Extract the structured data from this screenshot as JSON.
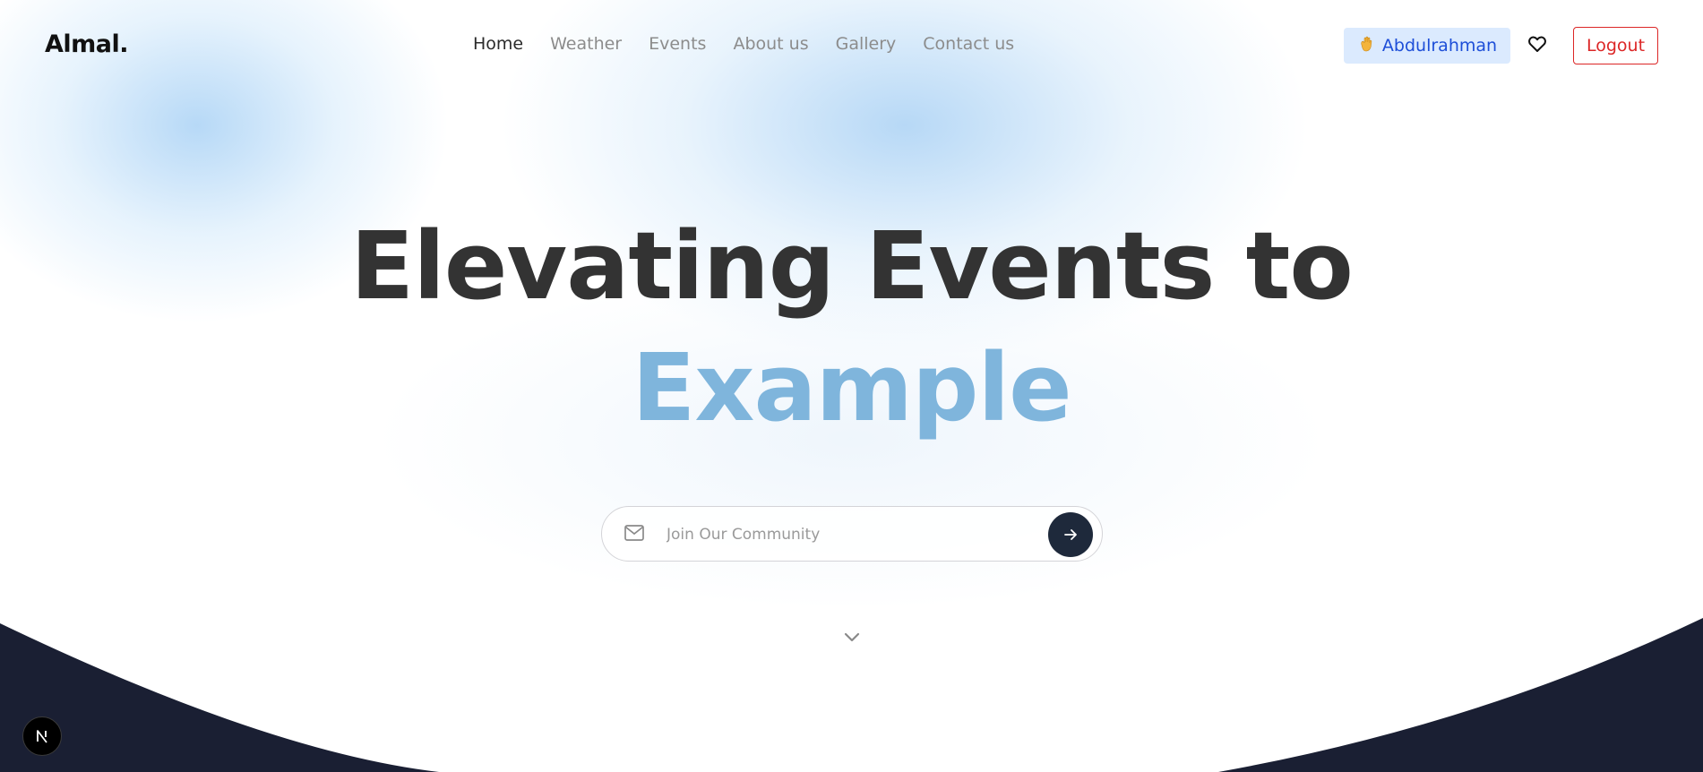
{
  "navbar": {
    "logo": "Almal.",
    "links": [
      "Home",
      "Weather",
      "Events",
      "About us",
      "Gallery",
      "Contact us"
    ],
    "active_link": "Home",
    "user_name": "Abdulrahman",
    "user_icon": "waving-hand-icon",
    "favorites_icon": "heart-icon",
    "logout_label": "Logout"
  },
  "hero": {
    "headline": "Elevating Events to",
    "highlight": "Example"
  },
  "join": {
    "placeholder": "Join Our Community",
    "input_icon": "mail-icon",
    "submit_icon": "arrow-right-icon"
  },
  "scroll_icon": "chevron-down-icon",
  "dev_badge_icon": "nextjs-logo-icon",
  "colors": {
    "primary_text": "#333333",
    "highlight": "#7fb5dc",
    "dark": "#1a1f33",
    "badge_bg": "#dbeafe",
    "badge_text": "#1d4ed8",
    "logout": "#dc2626"
  }
}
